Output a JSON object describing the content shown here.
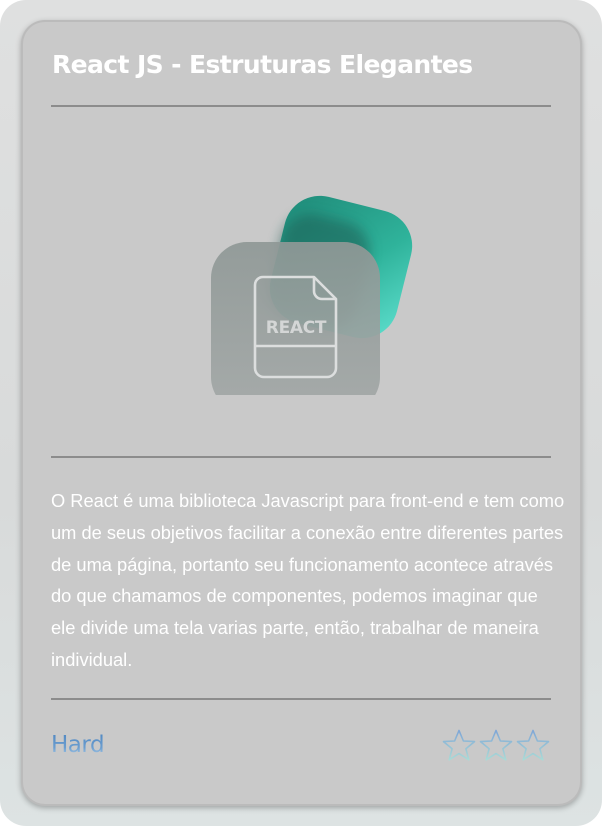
{
  "card": {
    "title": "React JS - Estruturas Elegantes",
    "logo": {
      "icon": "react-file-icon",
      "label": "REACT",
      "accent_color": "#35c2a8"
    },
    "description": "O React é uma biblioteca Javascript para front-end e tem como um de seus objetivos facilitar a conexão entre diferentes partes de uma página, portanto seu funcionamento acontece através do que chamamos de componentes, podemos imaginar que ele divide uma tela varias parte, então, trabalhar de maneira individual.",
    "difficulty": {
      "label": "Hard",
      "color": "#5e92c9"
    },
    "rating": {
      "icon": "star-outline-icon",
      "max": 3,
      "value": 0
    }
  }
}
